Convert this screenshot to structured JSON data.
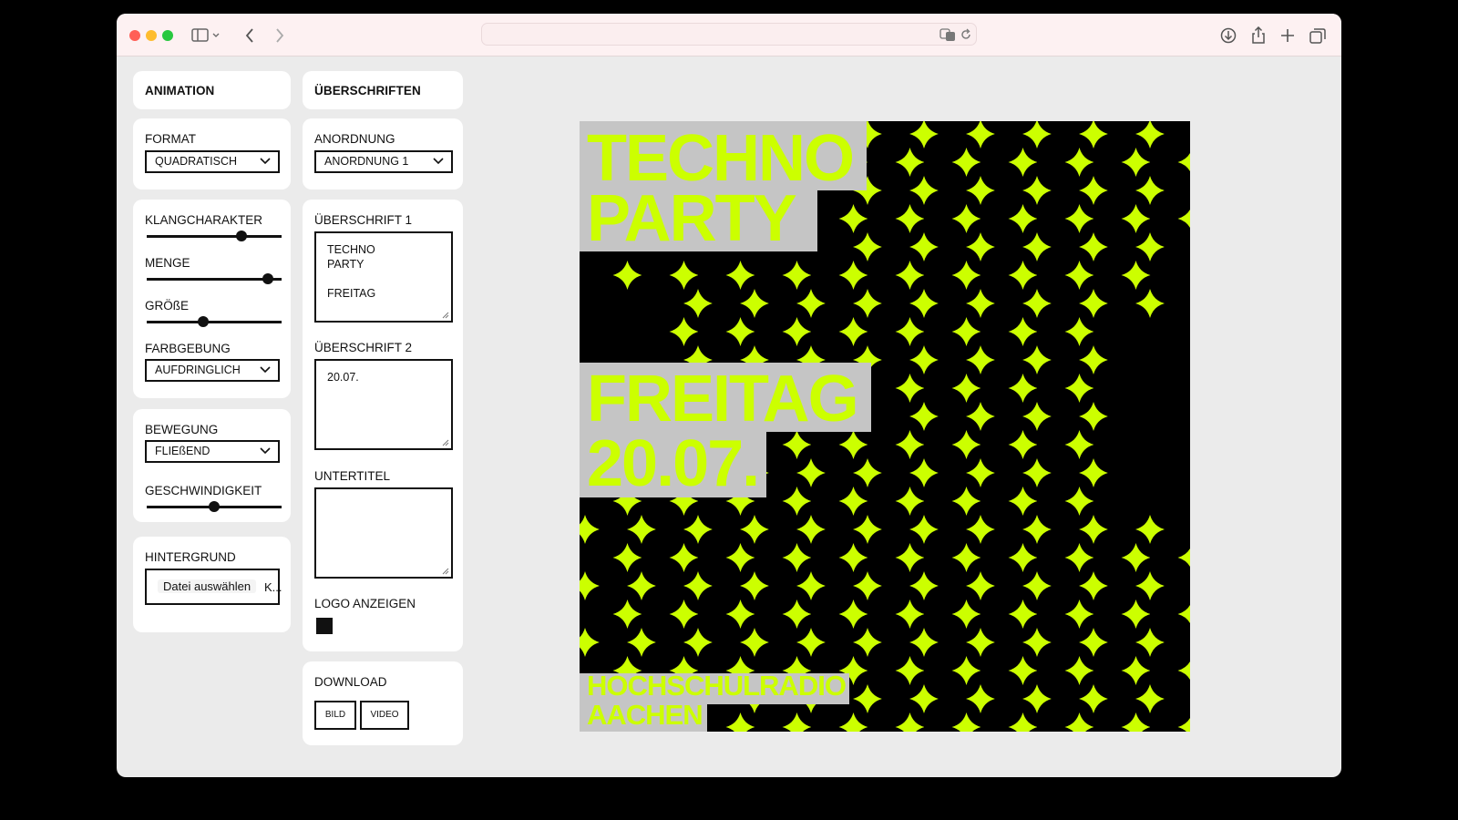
{
  "panel_left": {
    "header": "ANIMATION",
    "format": {
      "label": "FORMAT",
      "value": "QUADRATISCH"
    },
    "klangcharakter": {
      "label": "KLANGCHARAKTER",
      "value": 0.7
    },
    "menge": {
      "label": "MENGE",
      "value": 0.9
    },
    "groesse": {
      "label": "GRÖßE",
      "value": 0.42
    },
    "farbgebung": {
      "label": "FARBGEBUNG",
      "value": "AUFDRINGLICH"
    },
    "bewegung": {
      "label": "BEWEGUNG",
      "value": "FLIEßEND"
    },
    "geschwindigkeit": {
      "label": "GESCHWINDIGKEIT",
      "value": 0.5
    },
    "hintergrund": {
      "label": "HINTERGRUND",
      "button": "Datei auswählen",
      "status": "K..."
    }
  },
  "panel_right": {
    "header": "ÜBERSCHRIFTEN",
    "anordnung": {
      "label": "ANORDNUNG",
      "value": "ANORDNUNG 1"
    },
    "ueberschrift1": {
      "label": "ÜBERSCHRIFT 1",
      "value": "TECHNO\nPARTY\n\nFREITAG"
    },
    "ueberschrift2": {
      "label": "ÜBERSCHRIFT 2",
      "value": "20.07."
    },
    "untertitel": {
      "label": "UNTERTITEL",
      "value": ""
    },
    "logo": {
      "label": "LOGO ANZEIGEN",
      "checked": true
    },
    "download": {
      "label": "DOWNLOAD",
      "bild": "BILD",
      "video": "VIDEO"
    }
  },
  "poster": {
    "line1": "TECHNO",
    "line2": "PARTY",
    "line3": "FREITAG",
    "line4": "20.07.",
    "logo1": "HOCHSCHULRADIO",
    "logo2": "AACHEN",
    "accent": "#ccff00",
    "box": "#c5c5c5",
    "background": "#000000"
  },
  "colors": {
    "close": "#ff5f57",
    "minimize": "#febc2e",
    "zoom": "#28c840"
  }
}
